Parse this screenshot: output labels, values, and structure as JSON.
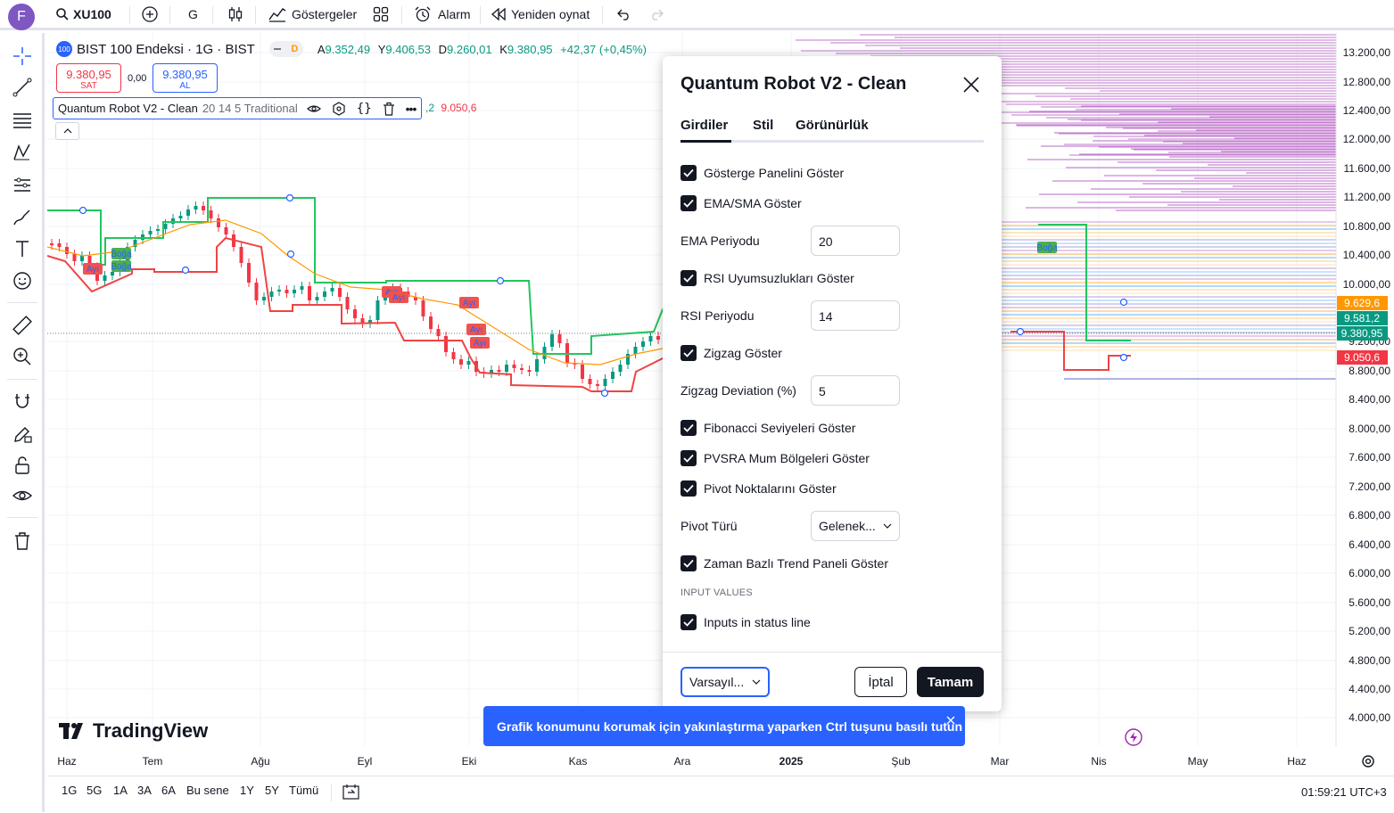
{
  "topbar": {
    "avatar_letter": "F",
    "symbol": "XU100",
    "interval": "G",
    "indicators_label": "Göstergeler",
    "alarm_label": "Alarm",
    "replay_label": "Yeniden oynat"
  },
  "legend": {
    "index_badge": "100",
    "title": "BIST 100 Endeksi · 1G · BIST",
    "d_badge": "D",
    "ohlc": {
      "a_label": "A",
      "a_value": "9.352,49",
      "y_label": "Y",
      "y_value": "9.406,53",
      "d_label": "D",
      "d_value": "9.260,01",
      "k_label": "K",
      "k_value": "9.380,95",
      "change": "+42,37 (+0,45%)"
    },
    "sell_price": "9.380,95",
    "sell_label": "SAT",
    "spread": "0,00",
    "buy_price": "9.380,95",
    "buy_label": "AL",
    "indicator_name": "Quantum Robot V2 - Clean",
    "indicator_params": "20 14 5 Traditional",
    "indicator_value_1": ",2",
    "indicator_value_2": "9.050,6"
  },
  "chart": {
    "watermark": "TradingView",
    "price_axis": [
      "13.200,00",
      "12.800,00",
      "12.400,00",
      "12.000,00",
      "11.600,00",
      "11.200,00",
      "10.800,00",
      "10.400,00",
      "10.000,00",
      "9.200,00",
      "8.800,00",
      "8.400,00",
      "8.000,00",
      "7.600,00",
      "7.200,00",
      "6.800,00",
      "6.400,00",
      "6.000,00",
      "5.600,00",
      "5.200,00",
      "4.800,00",
      "4.400,00",
      "4.000,00"
    ],
    "price_tags": [
      {
        "label": "9.629,6",
        "color": "#ff9800"
      },
      {
        "label": "9.581,2",
        "color": "#089981"
      },
      {
        "label": "9.380,95",
        "color": "#089981"
      },
      {
        "label": "9.050,6",
        "color": "#f23645"
      }
    ],
    "time_axis": [
      "Haz",
      "Tem",
      "Ağu",
      "Eyl",
      "Eki",
      "Kas",
      "Ara",
      "2025",
      "Şub",
      "Mar",
      "Nis",
      "May",
      "Haz"
    ],
    "signal_labels": {
      "bull": "Boğa",
      "bear": "Ayı"
    }
  },
  "bottombar": {
    "ranges": [
      "1G",
      "5G",
      "1A",
      "3A",
      "6A",
      "Bu sene",
      "1Y",
      "5Y",
      "Tümü"
    ],
    "clock": "01:59:21 UTC+3"
  },
  "dialog": {
    "title": "Quantum Robot V2 - Clean",
    "tabs": [
      "Girdiler",
      "Stil",
      "Görünürlük"
    ],
    "show_panel": "Gösterge Panelini Göster",
    "show_ema": "EMA/SMA Göster",
    "ema_label": "EMA Periyodu",
    "ema_value": "20",
    "show_rsi": "RSI Uyumsuzlukları Göster",
    "rsi_label": "RSI Periyodu",
    "rsi_value": "14",
    "show_zigzag": "Zigzag Göster",
    "zigzag_label": "Zigzag Deviation (%)",
    "zigzag_value": "5",
    "show_fib": "Fibonacci Seviyeleri Göster",
    "show_pvsra": "PVSRA Mum Bölgeleri Göster",
    "show_pivot": "Pivot Noktalarını Göster",
    "pivot_type_label": "Pivot Türü",
    "pivot_type_value": "Gelenek...",
    "show_trend": "Zaman Bazlı Trend Paneli Göster",
    "section_input_values": "INPUT VALUES",
    "inputs_status": "Inputs in status line",
    "defaults": "Varsayıl...",
    "cancel": "İptal",
    "ok": "Tamam"
  },
  "toast": {
    "text": "Grafik konumunu korumak için yakınlaştırma yaparken Ctrl tuşunu basılı tutun"
  }
}
